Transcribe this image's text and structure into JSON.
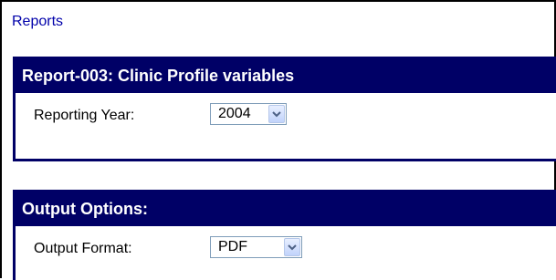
{
  "breadcrumb": {
    "label": "Reports"
  },
  "report_section": {
    "title": "Report-003: Clinic Profile variables",
    "reporting_year": {
      "label": "Reporting Year:",
      "value": "2004",
      "icon": "chevron-down-icon"
    }
  },
  "output_section": {
    "title": "Output Options:",
    "output_format": {
      "label": "Output Format:",
      "value": "PDF",
      "icon": "chevron-down-icon"
    }
  },
  "colors": {
    "header_bg": "#000066",
    "header_text": "#ffffff",
    "link": "#0000aa",
    "select_border": "#7f9db9",
    "select_button": "#c1d3fb"
  }
}
